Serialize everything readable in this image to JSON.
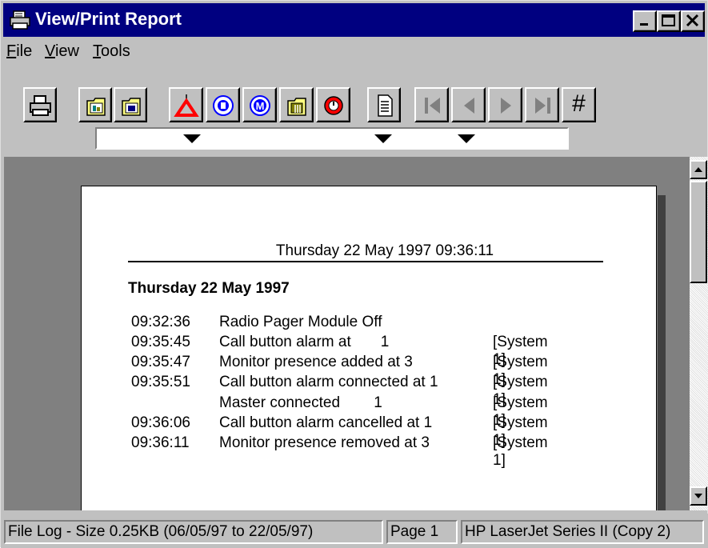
{
  "window": {
    "title": "View/Print Report"
  },
  "menu": {
    "items": [
      {
        "label": "File",
        "key": "F",
        "rest": "ile"
      },
      {
        "label": "View",
        "key": "V",
        "rest": "iew"
      },
      {
        "label": "Tools",
        "key": "T",
        "rest": "ools"
      }
    ]
  },
  "toolbar": {
    "icons": [
      "printer-icon",
      "open-folder-icon",
      "folder-icon",
      "alarm-triangle-icon",
      "radio-pager-icon",
      "monitor-icon",
      "call-point-icon",
      "stop-icon",
      "document-icon",
      "first-page-icon",
      "prev-page-icon",
      "next-page-icon",
      "last-page-icon",
      "goto-page-icon"
    ],
    "goto_label": "#"
  },
  "report": {
    "header": "Thursday 22 May 1997 09:36:11",
    "date_heading": "Thursday 22 May 1997",
    "rows": [
      {
        "time": "09:32:36",
        "message": "Radio Pager Module Off",
        "system": ""
      },
      {
        "time": "09:35:45",
        "message": "Call button alarm at       1",
        "system": "[System 1]"
      },
      {
        "time": "09:35:47",
        "message": "Monitor presence added at 3",
        "system": "[System 1]"
      },
      {
        "time": "09:35:51",
        "message": "Call button alarm connected at 1",
        "system": "[System 1]"
      },
      {
        "time": "",
        "message": "Master connected        1",
        "system": "[System 1]"
      },
      {
        "time": "09:36:06",
        "message": "Call button alarm cancelled at 1",
        "system": "[System 1]"
      },
      {
        "time": "09:36:11",
        "message": "Monitor presence removed at 3",
        "system": "[System 1]"
      }
    ]
  },
  "status": {
    "file_info": "File Log - Size 0.25KB (06/05/97 to 22/05/97)",
    "page": "Page 1",
    "printer": "HP LaserJet Series II (Copy 2)"
  },
  "colors": {
    "titlebar": "#000080",
    "face": "#c0c0c0",
    "alarm_red": "#ff0000",
    "info_blue": "#0000ff"
  }
}
